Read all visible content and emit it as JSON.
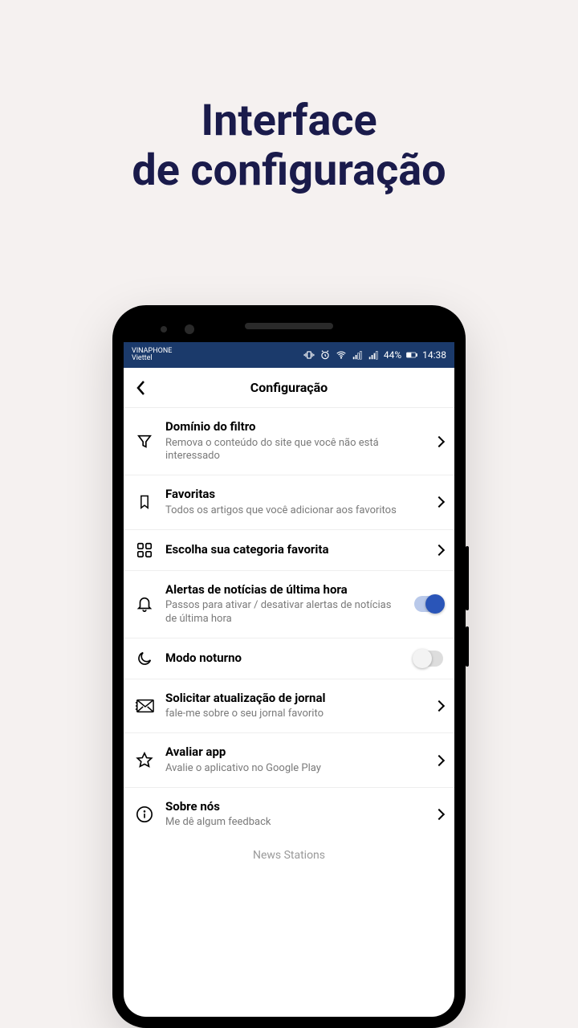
{
  "hero": {
    "line1": "Interface",
    "line2": "de configuração"
  },
  "status": {
    "carrier1": "VINAPHONE",
    "carrier2": "Viettel",
    "battery_pct": "44%",
    "time": "14:38"
  },
  "header": {
    "title": "Configuração"
  },
  "items": [
    {
      "icon": "filter-icon",
      "title": "Domínio do filtro",
      "sub": "Remova o conteúdo do site que você não está interessado",
      "trail": "chevron"
    },
    {
      "icon": "bookmark-icon",
      "title": "Favoritas",
      "sub": "Todos os artigos que você adicionar aos favoritos",
      "trail": "chevron"
    },
    {
      "icon": "grid-icon",
      "title": "Escolha sua categoria favorita",
      "sub": "",
      "trail": "chevron"
    },
    {
      "icon": "bell-icon",
      "title": "Alertas de notícias de última hora",
      "sub": "Passos para ativar / desativar alertas de notícias de última hora",
      "trail": "toggle-on"
    },
    {
      "icon": "moon-icon",
      "title": "Modo noturno",
      "sub": "",
      "trail": "toggle-off"
    },
    {
      "icon": "mail-icon",
      "title": "Solicitar atualização de jornal",
      "sub": "fale-me sobre o seu jornal favorito",
      "trail": "chevron"
    },
    {
      "icon": "star-icon",
      "title": "Avaliar app",
      "sub": "Avalie o aplicativo no Google Play",
      "trail": "chevron"
    },
    {
      "icon": "info-icon",
      "title": "Sobre nós",
      "sub": "Me dê algum feedback",
      "trail": "chevron"
    }
  ],
  "footer": {
    "app_name": "News Stations"
  }
}
